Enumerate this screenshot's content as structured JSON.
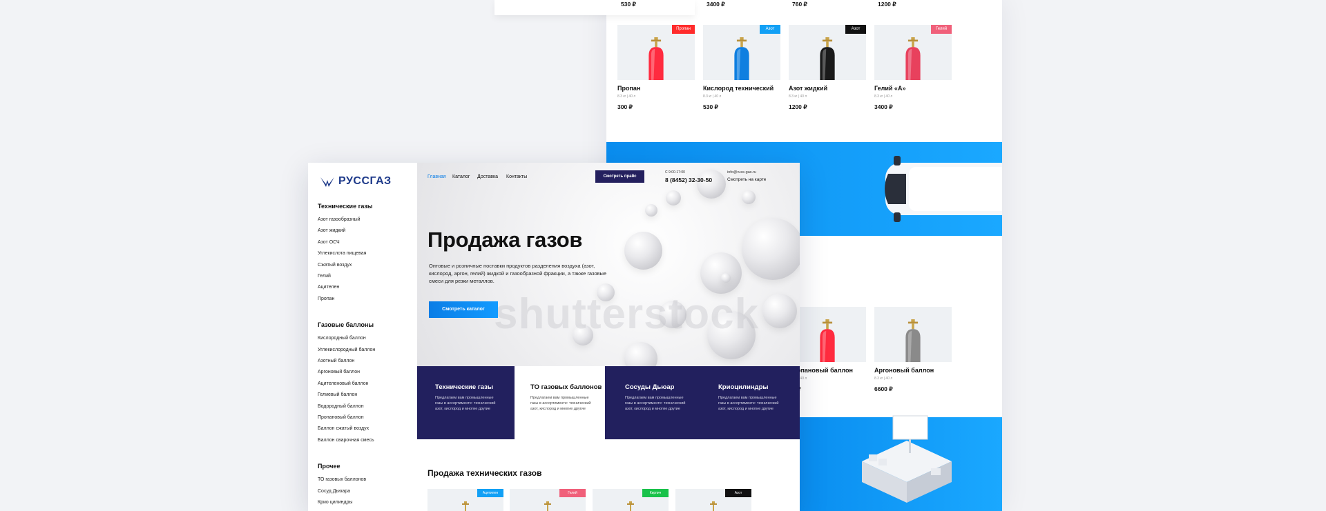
{
  "top_prices": [
    "530 ₽",
    "3400 ₽",
    "760 ₽",
    "1200 ₽"
  ],
  "products_row": [
    {
      "name": "Пропан",
      "spec": "8.3 кг | 40 л",
      "price": "300 ₽",
      "tag": "Пропан",
      "tag_color": "#ff2b2b",
      "color": "#ff2b3f"
    },
    {
      "name": "Кислород технический",
      "spec": "8.3 кг | 40 л",
      "price": "530 ₽",
      "tag": "Азот",
      "tag_color": "#12a0f5",
      "color": "#0f7fe0"
    },
    {
      "name": "Азот жидкий",
      "spec": "8.3 кг | 40 л",
      "price": "1200 ₽",
      "tag": "Азот",
      "tag_color": "#111111",
      "color": "#1a1a1a"
    },
    {
      "name": "Гелий «А»",
      "spec": "8.3 кг | 40 л",
      "price": "3400 ₽",
      "tag": "Гелий",
      "tag_color": "#f0607a",
      "color": "#e8415d"
    }
  ],
  "products_row2": [
    {
      "name": "Пропановый баллон",
      "spec": "8.3 кг | 40 л",
      "price": "00 ₽",
      "color": "#ff2b3f"
    },
    {
      "name": "Аргоновый баллон",
      "spec": "8.3 кг | 40 л",
      "price": "6600 ₽",
      "color": "#8a8a8a"
    }
  ],
  "logo": "РУССГАЗ",
  "sidebar": {
    "groups": [
      {
        "title": "Технические газы",
        "items": [
          "Азот газообразный",
          "Азот жидкий",
          "Азот ОСЧ",
          "Углекислота пищевая",
          "Сжатый воздух",
          "Гелий",
          "Ацителен",
          "Пропан"
        ]
      },
      {
        "title": "Газовые баллоны",
        "items": [
          "Кислородный баллон",
          "Углекислородный баллон",
          "Азотный баллон",
          "Аргоновый баллон",
          "Ацителеновый баллон",
          "Гелиевый баллон",
          "Водородный баллон",
          "Пропановый баллон",
          "Баллон сжатый воздух",
          "Баллон сварочная смесь"
        ]
      },
      {
        "title": "Прочее",
        "items": [
          "ТО газовых баллонов",
          "Сосуд Дьюара",
          "Крио цилиндры"
        ]
      }
    ]
  },
  "nav": [
    "Главная",
    "Каталог",
    "Доставка",
    "Контакты"
  ],
  "header": {
    "price_button": "Смотреть прайс",
    "hours": "С 9:00-17:00",
    "phone": "8 (8452) 32-30-50",
    "email": "info@russ-gas.ru",
    "map_link": "Смотреть на карте"
  },
  "hero": {
    "title": "Продажа газов",
    "description": "Оптовые и розничные поставки продуктов разделения воздуха (азот, кислород, аргон, гелий) жидкой и газообразной фракции, а также газовые смеси для резки металлов.",
    "cta": "Смотреть каталог",
    "watermark": "shutterstock"
  },
  "tiles": [
    {
      "title": "Технические газы",
      "text": "Предлагаем вам промышленные газы в ассортименте: технический азот, кислород и многие другие"
    },
    {
      "title": "ТО газовых баллонов",
      "text": "Предлагаем вам промышленные газы в ассортименте: технический азот, кислород и многие другие"
    },
    {
      "title": "Сосуды Дьюар",
      "text": "Предлагаем вам промышленные газы в ассортименте: технический азот, кислород и многие другие"
    },
    {
      "title": "Криоцилиндры",
      "text": "Предлагаем вам промышленные газы в ассортименте: технический азот, кислород и многие другие"
    }
  ],
  "section_title": "Продажа технических газов",
  "mini_tags": [
    {
      "label": "Ацетилен",
      "color": "#12a0f5"
    },
    {
      "label": "Гелий",
      "color": "#f0607a"
    },
    {
      "label": "Кирпич",
      "color": "#19c24a"
    },
    {
      "label": "Азот",
      "color": "#111111"
    }
  ],
  "colors": {
    "brand": "#22205e",
    "accent": "#0a8ef0"
  }
}
